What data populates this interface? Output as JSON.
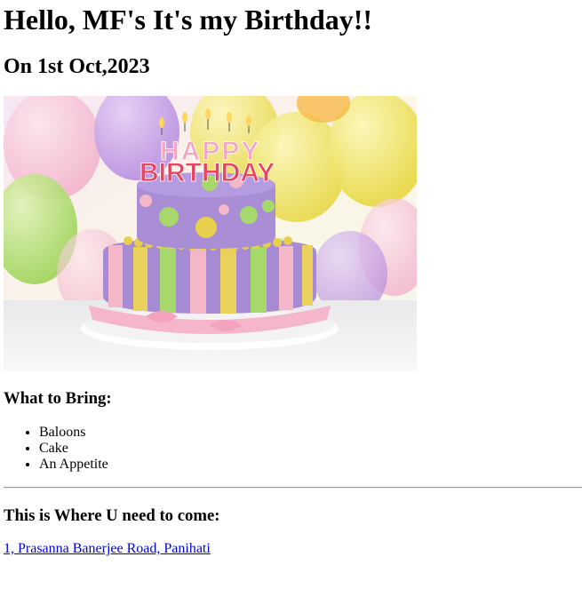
{
  "title": "Hello, MF's It's my Birthday!!",
  "date": "On 1st Oct,2023",
  "image": {
    "subject": "birthday cake with HAPPY BIRTHDAY candles and balloons",
    "candles_top": "HAPPY",
    "candles_bottom": "BIRTHDAY"
  },
  "bring": {
    "title": "What to Bring:",
    "items": [
      "Baloons",
      "Cake",
      "An Appetite"
    ]
  },
  "where": {
    "title": "This is Where U need to come:",
    "address_link": "1, Prasanna Banerjee Road, Panihati"
  },
  "colors": {
    "link": "#0000ee",
    "cake_purple": "#a78bd8",
    "cake_pink": "#f4b6c8",
    "cake_yellow": "#e8d45a",
    "cake_green": "#a8d86e"
  }
}
